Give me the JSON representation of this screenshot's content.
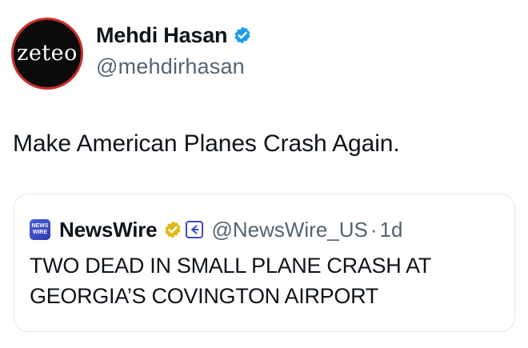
{
  "tweet": {
    "author": {
      "avatar_logo_text": "zeteo",
      "display_name": "Mehdi Hasan",
      "handle": "@mehdirhasan",
      "verified_color": "#1d9bf0"
    },
    "text": "Make American Planes Crash Again."
  },
  "quoted_tweet": {
    "logo_line1": "NEWS",
    "logo_line2": "WIRE",
    "display_name": "NewsWire",
    "handle": "@NewsWire_US",
    "separator": "·",
    "time": "1d",
    "text": "TWO DEAD IN SMALL PLANE CRASH AT GEORGIA’S COVINGTON AIRPORT",
    "verified_color": "#e2b719",
    "affiliate_color": "#3b4bc4"
  }
}
